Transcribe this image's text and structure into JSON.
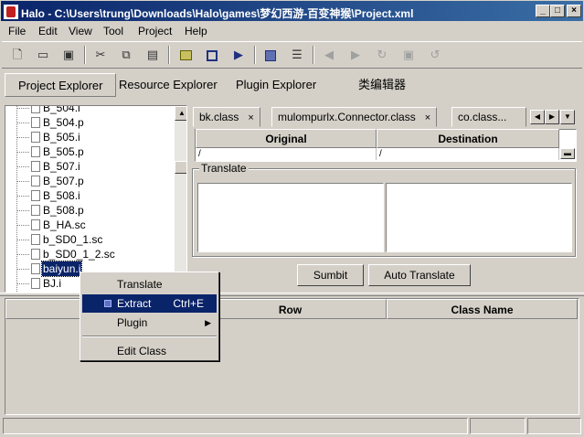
{
  "window": {
    "title": "Halo - C:\\Users\\trung\\Downloads\\Halo\\games\\梦幻西游-百变神猴\\Project.xml"
  },
  "menubar": [
    "File",
    "Edit",
    "View",
    "Tool",
    "Project",
    "Help"
  ],
  "toolbar": {
    "icons": [
      "new-file-icon",
      "open-folder-icon",
      "save-icon",
      "cut-icon",
      "copy-icon",
      "paste-icon",
      "image-icon",
      "frame-icon",
      "run-icon",
      "component-icon",
      "panel-icon",
      "back-icon",
      "forward-icon",
      "refresh-icon",
      "stop-icon",
      "undo-icon"
    ]
  },
  "explorer_tabs": [
    "Project Explorer",
    "Resource Explorer",
    "Plugin Explorer",
    "类编辑器"
  ],
  "tree": {
    "items": [
      "B_504.i",
      "B_504.p",
      "B_505.i",
      "B_505.p",
      "B_507.i",
      "B_507.p",
      "B_508.i",
      "B_508.p",
      "B_HA.sc",
      "b_SD0_1.sc",
      "b_SD0_1_2.sc",
      "baiyun.i",
      "BJ.i"
    ],
    "selected": "baiyun.i"
  },
  "file_tabs": [
    {
      "label": "bk.class",
      "close": "×"
    },
    {
      "label": "mulompurlx.Connector.class",
      "close": "×"
    },
    {
      "label": "co.class..."
    }
  ],
  "grid": {
    "columns": [
      "Original",
      "Destination"
    ],
    "row": [
      "/",
      "/"
    ]
  },
  "translate": {
    "label": "Translate",
    "submit": "Sumbit",
    "auto": "Auto Translate"
  },
  "bottom_table": {
    "columns": [
      "",
      "Row",
      "Class Name"
    ]
  },
  "context_menu": {
    "items": [
      {
        "label": "Translate"
      },
      {
        "label": "Extract",
        "accel": "Ctrl+E",
        "highlighted": true
      },
      {
        "label": "Plugin",
        "submenu": "▶"
      },
      {
        "label": "Edit Class"
      }
    ]
  }
}
